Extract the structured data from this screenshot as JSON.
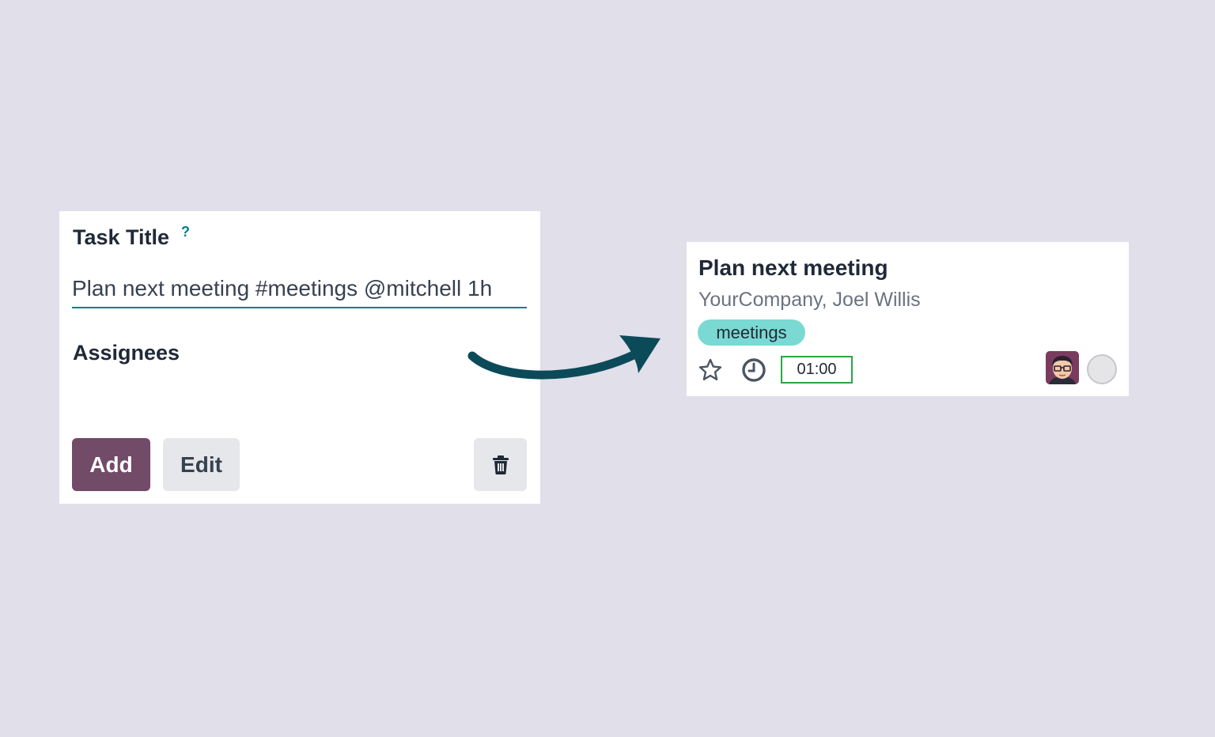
{
  "form": {
    "title_label": "Task Title",
    "help_mark": "?",
    "title_value": "Plan next meeting #meetings @mitchell 1h",
    "assignees_label": "Assignees",
    "add_label": "Add",
    "edit_label": "Edit"
  },
  "card": {
    "task_name": "Plan next meeting",
    "partner": "YourCompany, Joel Willis",
    "tag": "meetings",
    "allocated_hours": "01:00"
  },
  "colors": {
    "background": "#e0dfea",
    "primary": "#714b67",
    "accent": "#017e84",
    "tag": "#7ad9d2",
    "hours_border": "#28a745",
    "arrow": "#0b4a59"
  },
  "icons": {
    "help": "question-mark-icon",
    "delete": "trash-icon",
    "arrow": "curved-arrow-icon",
    "favorite": "star-icon",
    "deadline": "clock-icon",
    "assignee": "user-avatar",
    "status": "status-circle-icon"
  }
}
